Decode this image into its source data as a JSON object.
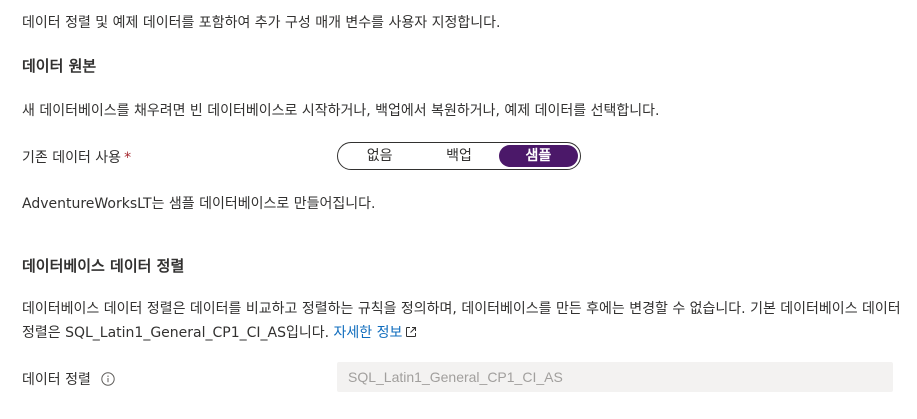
{
  "intro": "데이터 정렬 및 예제 데이터를 포함하여 추가 구성 매개 변수를 사용자 지정합니다.",
  "data_source": {
    "heading": "데이터 원본",
    "description": "새 데이터베이스를 채우려면 빈 데이터베이스로 시작하거나, 백업에서 복원하거나, 예제 데이터를 선택합니다.",
    "use_existing_label": "기존 데이터 사용",
    "required_marker": "*",
    "options": [
      {
        "label": "없음",
        "selected": false
      },
      {
        "label": "백업",
        "selected": false
      },
      {
        "label": "샘플",
        "selected": true
      }
    ],
    "sample_note": "AdventureWorksLT는 샘플 데이터베이스로 만들어집니다."
  },
  "collation": {
    "heading": "데이터베이스 데이터 정렬",
    "description_text": "데이터베이스 데이터 정렬은 데이터를 비교하고 정렬하는 규칙을 정의하며, 데이터베이스를 만든 후에는 변경할 수 없습니다. 기본 데이터베이스 데이터 정렬은 SQL_Latin1_General_CP1_CI_AS입니다. ",
    "learn_more": "자세한 정보",
    "field_label": "데이터 정렬",
    "field_value": "SQL_Latin1_General_CP1_CI_AS"
  },
  "colors": {
    "accent": "#4b1869",
    "link": "#0f6cbd",
    "required": "#a4262c"
  },
  "icons": {
    "external_link": "external-link-icon",
    "info": "info-icon"
  }
}
